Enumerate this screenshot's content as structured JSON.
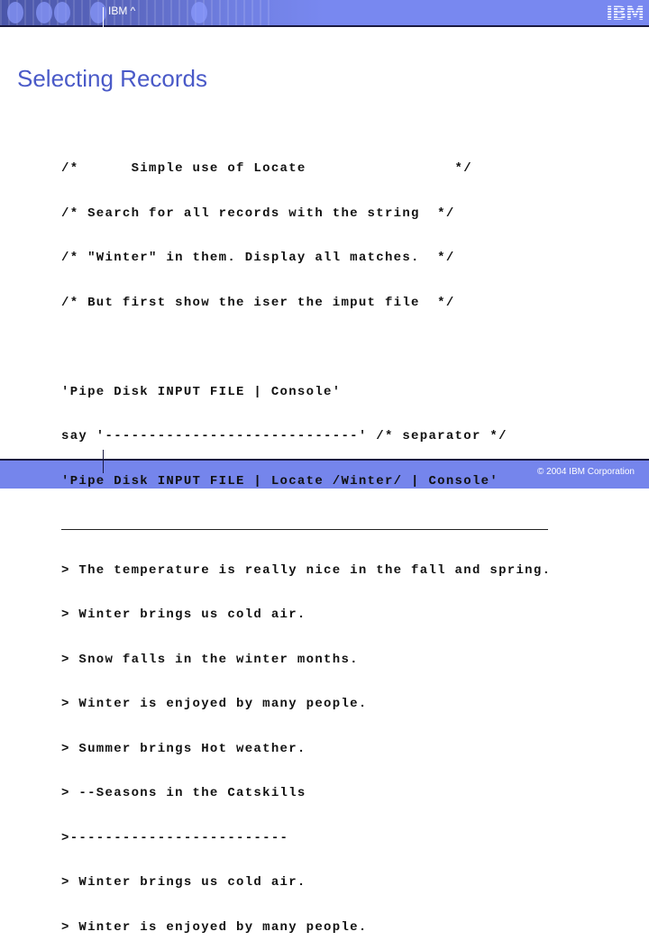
{
  "header": {
    "title": "IBM ^",
    "logo": "IBM"
  },
  "page_title": "Selecting Records",
  "code": {
    "comments": [
      "/*      Simple use of Locate                 */",
      "/* Search for all records with the string  */",
      "/* \"Winter\" in them. Display all matches.  */",
      "/* But first show the iser the imput file  */"
    ],
    "commands": [
      "'Pipe Disk INPUT FILE | Console'",
      "say '-----------------------------' /* separator */",
      "'Pipe Disk INPUT FILE | Locate /Winter/ | Console'"
    ],
    "output": [
      "> The temperature is really nice in the fall and spring.",
      "> Winter brings us cold air.",
      "> Snow falls in the winter months.",
      "> Winter is enjoyed by many people.",
      "> Summer brings Hot weather.",
      "> --Seasons in the Catskills",
      ">-------------------------",
      "> Winter brings us cold air.",
      "> Winter is enjoyed by many people."
    ]
  },
  "footer": {
    "copyright": "© 2004 IBM Corporation"
  },
  "colors": {
    "banner": "#7888f0",
    "title": "#4a5ac8"
  }
}
